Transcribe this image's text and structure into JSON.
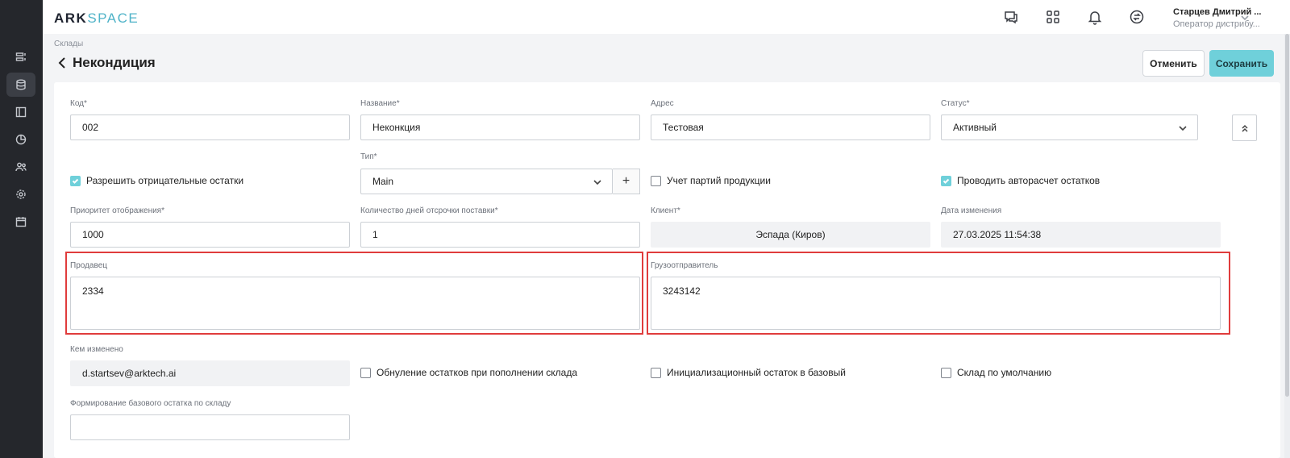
{
  "app": {
    "logo_ark": "ARK",
    "logo_space": "SPACE"
  },
  "sidebar": {
    "items": [
      {
        "icon": "layers-icon"
      },
      {
        "icon": "database-icon",
        "active": true
      },
      {
        "icon": "layout-icon"
      },
      {
        "icon": "pie-chart-icon"
      },
      {
        "icon": "users-icon"
      },
      {
        "icon": "settings-icon"
      },
      {
        "icon": "calendar-icon"
      }
    ]
  },
  "topbar": {
    "icons": [
      "chat-help-icon",
      "apps-grid-icon",
      "bell-icon",
      "sync-icon"
    ],
    "user_name": "Старцев Дмитрий ...",
    "user_role": "Оператор дистрибу..."
  },
  "page": {
    "breadcrumb": "Склады",
    "title": "Некондиция",
    "cancel_label": "Отменить",
    "save_label": "Сохранить"
  },
  "form": {
    "code": {
      "label": "Код*",
      "value": "002"
    },
    "name": {
      "label": "Название*",
      "value": "Неконкция"
    },
    "address": {
      "label": "Адрес",
      "value": "Тестовая"
    },
    "status": {
      "label": "Статус*",
      "value": "Активный"
    },
    "type": {
      "label": "Тип*",
      "value": "Main",
      "add": "+"
    },
    "allow_negative": {
      "label": "Разрешить отрицательные остатки",
      "checked": true
    },
    "batch_tracking": {
      "label": "Учет партий продукции",
      "checked": false
    },
    "auto_calc": {
      "label": "Проводить авторасчет остатков",
      "checked": true
    },
    "display_priority": {
      "label": "Приоритет отображения*",
      "value": "1000"
    },
    "delay_days": {
      "label": "Количество дней отсрочки поставки*",
      "value": "1"
    },
    "client": {
      "label": "Клиент*",
      "value": "Эспада (Киров)"
    },
    "changed_date": {
      "label": "Дата изменения",
      "value": "27.03.2025 11:54:38"
    },
    "seller": {
      "label": "Продавец",
      "value": "2334"
    },
    "shipper": {
      "label": "Грузоотправитель",
      "value": "3243142"
    },
    "changed_by": {
      "label": "Кем изменено",
      "value": "d.startsev@arktech.ai"
    },
    "reset_on_refill": {
      "label": "Обнуление остатков при пополнении склада",
      "checked": false
    },
    "init_to_base": {
      "label": "Инициализационный остаток в базовый",
      "checked": false
    },
    "default_warehouse": {
      "label": "Склад по умолчанию",
      "checked": false
    },
    "base_formation": {
      "label": "Формирование базового остатка по складу",
      "value": ""
    }
  },
  "colors": {
    "accent": "#6fd0da",
    "highlight": "#e03c3c",
    "rail": "#25272c"
  }
}
